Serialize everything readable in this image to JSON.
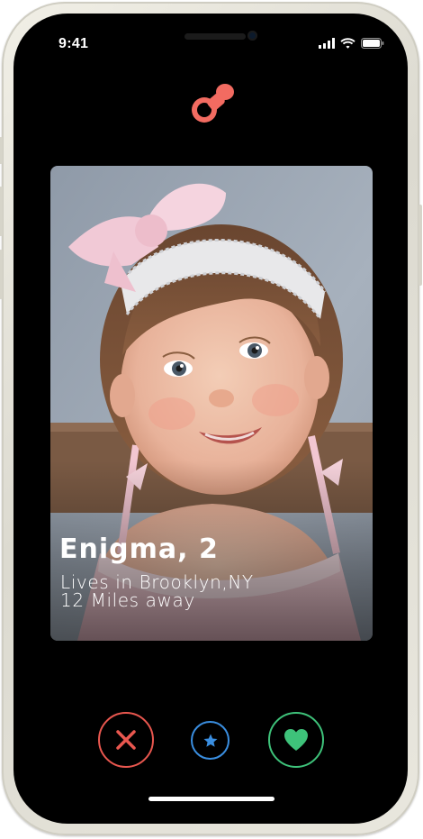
{
  "status_bar": {
    "time": "9:41",
    "icons": [
      "cellular-signal-icon",
      "wifi-icon",
      "battery-icon"
    ]
  },
  "header": {
    "logo_icon": "pacifier-icon",
    "logo_color": "#f26b61"
  },
  "profile_card": {
    "name_age": "Enigma, 2",
    "location": "Lives in Brooklyn,NY",
    "distance": "12 Miles away",
    "photo": "smiling-baby-with-pink-bow-photo"
  },
  "actions": [
    {
      "name": "dislike",
      "icon": "x-icon",
      "color": "#e9574f"
    },
    {
      "name": "super-like",
      "icon": "star-icon",
      "color": "#3a8ee0"
    },
    {
      "name": "like",
      "icon": "heart-icon",
      "color": "#3ec27a"
    }
  ]
}
